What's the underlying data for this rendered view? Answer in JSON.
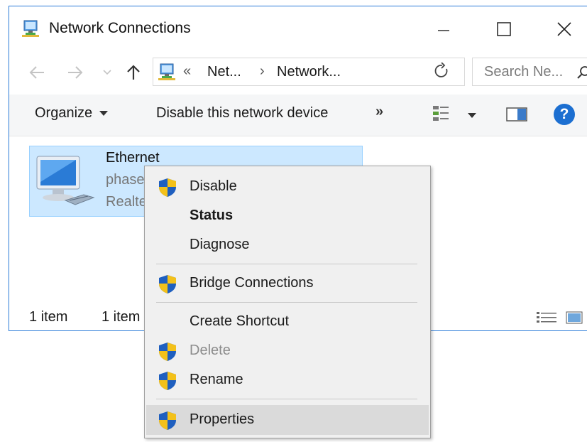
{
  "window": {
    "title": "Network Connections",
    "accent_color": "#2b7bd8"
  },
  "address": {
    "overflow": "«",
    "crumb1": "Net...",
    "sep": "›",
    "crumb2": "Network..."
  },
  "search": {
    "placeholder": "Search Ne..."
  },
  "toolbar": {
    "organize_label": "Organize",
    "disable_label": "Disable this network device",
    "more_label": "»",
    "help_label": "?"
  },
  "item": {
    "name": "Ethernet",
    "line2": "phase",
    "line3": "Realte",
    "selection_color": "#cce8ff"
  },
  "status": {
    "count": "1 item",
    "selected": "1 item"
  },
  "context_menu": {
    "items": [
      {
        "label": "Disable",
        "icon": "uac-shield-icon"
      },
      {
        "label": "Status"
      },
      {
        "label": "Diagnose"
      },
      {
        "label": "Bridge Connections",
        "icon": "uac-shield-icon"
      },
      {
        "label": "Create Shortcut"
      },
      {
        "label": "Delete",
        "icon": "uac-shield-icon",
        "disabled": true
      },
      {
        "label": "Rename",
        "icon": "uac-shield-icon"
      },
      {
        "label": "Properties",
        "icon": "uac-shield-icon",
        "highlighted": true
      }
    ]
  }
}
